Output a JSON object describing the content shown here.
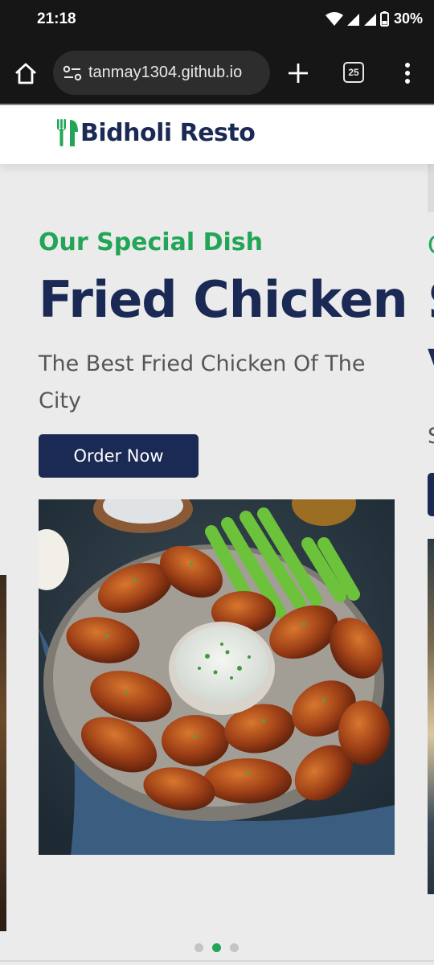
{
  "status_bar": {
    "time": "21:18",
    "battery": "30%",
    "icons": [
      "wifi-icon",
      "signal-icon",
      "signal-icon",
      "battery-icon"
    ]
  },
  "browser": {
    "url": "tanmay1304.github.io",
    "tab_count": "25",
    "icons": [
      "home-icon",
      "site-settings-icon",
      "plus-icon",
      "tabs-icon",
      "more-vert-icon"
    ]
  },
  "site": {
    "brand": "Bidholi Resto",
    "logo_icon": "utensils-icon",
    "colors": {
      "primary": "#1b2a55",
      "accent": "#22a556"
    }
  },
  "slide": {
    "subtitle": "Our Special Dish",
    "title": "Fried Chicken",
    "description": "The Best Fried Chicken Of The City",
    "button_label": "Order Now",
    "image": "fried-chicken-wings-photo"
  },
  "next_slide_peek": {
    "subtitle_initial": "O",
    "title_initial": "S",
    "line2_initial": "V",
    "desc_initial": "S"
  },
  "carousel": {
    "total_slides": 3,
    "active_index": 1
  }
}
